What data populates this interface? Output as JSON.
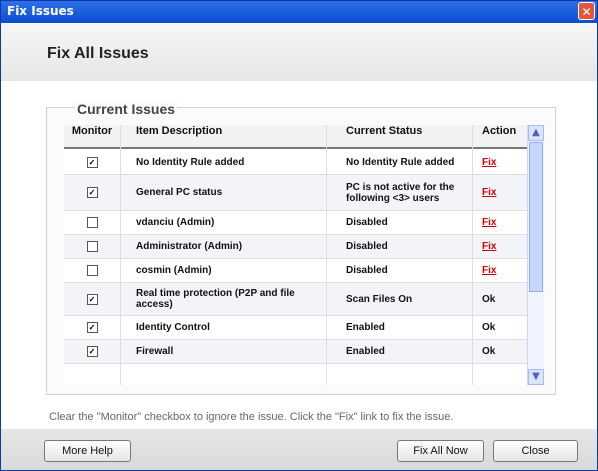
{
  "window": {
    "title": "Fix Issues",
    "close_glyph": "✕"
  },
  "header": {
    "title": "Fix All Issues"
  },
  "panel": {
    "legend": "Current Issues"
  },
  "table": {
    "columns": [
      "Monitor",
      "Item Description",
      "Current Status",
      "Action"
    ],
    "rows": [
      {
        "checked": true,
        "description": "No Identity Rule added",
        "status": "No Identity Rule added",
        "action": "Fix",
        "action_link": true
      },
      {
        "checked": true,
        "description": "General PC status",
        "status": "PC is not active for the following <3> users",
        "action": "Fix",
        "action_link": true
      },
      {
        "checked": false,
        "description": "vdanciu (Admin)",
        "status": "Disabled",
        "action": "Fix",
        "action_link": true
      },
      {
        "checked": false,
        "description": "Administrator (Admin)",
        "status": "Disabled",
        "action": "Fix",
        "action_link": true
      },
      {
        "checked": false,
        "description": "cosmin (Admin)",
        "status": "Disabled",
        "action": "Fix",
        "action_link": true
      },
      {
        "checked": true,
        "description": "Real time protection (P2P and file access)",
        "status": "Scan Files On",
        "action": "Ok",
        "action_link": false
      },
      {
        "checked": true,
        "description": "Identity Control",
        "status": "Enabled",
        "action": "Ok",
        "action_link": false
      },
      {
        "checked": true,
        "description": "Firewall",
        "status": "Enabled",
        "action": "Ok",
        "action_link": false
      }
    ]
  },
  "footnote": "Clear the \"Monitor\" checkbox to ignore the issue. Click the \"Fix\" link to fix the issue.",
  "buttons": {
    "more_help": "More Help",
    "fix_all_now": "Fix All Now",
    "close": "Close"
  },
  "colors": {
    "title_bar": "#0a4fd0",
    "fix_link": "#cc0000",
    "scrollbar_thumb": "#c7d6ff"
  }
}
